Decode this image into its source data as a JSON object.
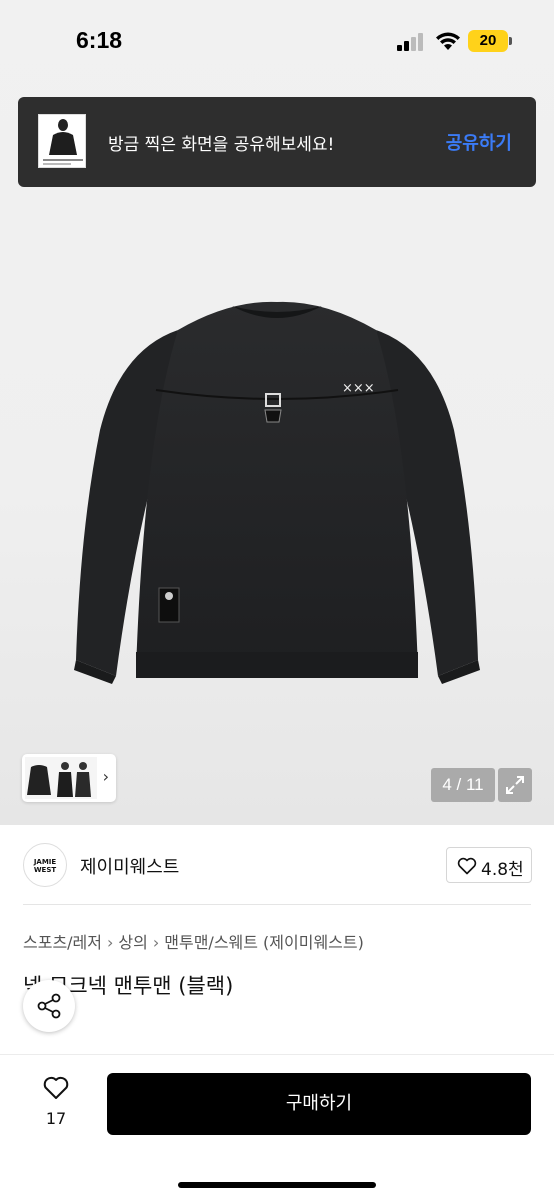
{
  "status_bar": {
    "time": "6:18",
    "battery": "20"
  },
  "share_toast": {
    "message": "방금 찍은 화면을 공유해보세요!",
    "action_label": "공유하기"
  },
  "gallery": {
    "counter": "4 / 11",
    "next_icon": "chevron-right-icon",
    "expand_icon": "expand-icon"
  },
  "brand": {
    "logo_line1": "JAMIE",
    "logo_line2": "WEST",
    "name": "제이미웨스트",
    "rating": "4.8천"
  },
  "breadcrumb": {
    "items": [
      "스포츠/레저",
      "상의",
      "맨투맨/스웨트 (제이미웨스트)"
    ]
  },
  "product": {
    "title": "넥 모크넥 맨투맨 (블랙)"
  },
  "bottom_bar": {
    "like_count": "17",
    "buy_label": "구매하기"
  },
  "colors": {
    "toast_bg": "#2e2e2e",
    "toast_action": "#3b7bf6",
    "buy_bg": "#000000",
    "battery": "#ffd21a"
  }
}
